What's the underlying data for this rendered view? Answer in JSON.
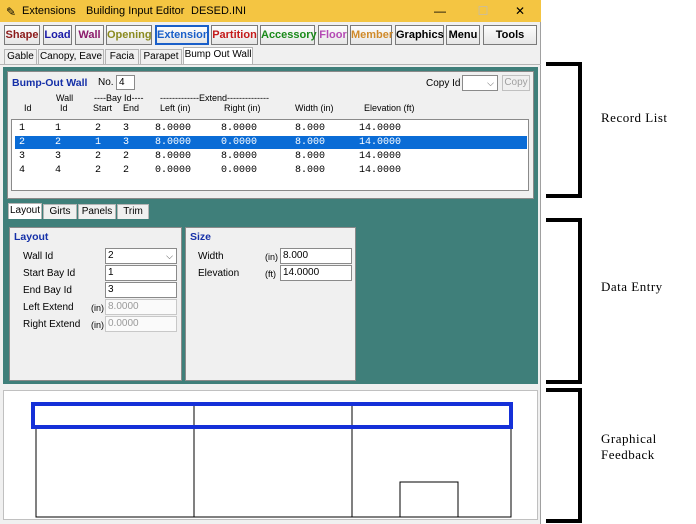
{
  "window": {
    "menu_extensions": "Extensions",
    "app_title": "Building Input Editor",
    "file": "DESED.INI",
    "min": "—",
    "max": "☐",
    "close": "✕"
  },
  "toolbar": [
    {
      "label": "Shape",
      "color": "#8b1a1a"
    },
    {
      "label": "Load",
      "color": "#1a1aa8"
    },
    {
      "label": "Wall",
      "color": "#8b1a6b"
    },
    {
      "label": "Opening",
      "color": "#8a8a20"
    },
    {
      "label": "Extension",
      "color": "#1a5fc9"
    },
    {
      "label": "Partition",
      "color": "#c41a1a"
    },
    {
      "label": "Accessory",
      "color": "#1a8a1a"
    },
    {
      "label": "Floor",
      "color": "#b44ab4"
    },
    {
      "label": "Member",
      "color": "#d08a2a"
    },
    {
      "label": "Graphics",
      "color": "#000000"
    },
    {
      "label": "Menu",
      "color": "#000000"
    },
    {
      "label": "Tools",
      "color": "#000000"
    }
  ],
  "subtabs": [
    "Gable",
    "Canopy, Eave",
    "Facia",
    "Parapet",
    "Bump Out Wall"
  ],
  "record": {
    "title": "Bump-Out Wall",
    "no_label": "No.",
    "no_value": "4",
    "copy_id_label": "Copy Id",
    "copy_btn": "Copy",
    "headers": {
      "id": "Id",
      "wall": "Wall",
      "wall_id": "Id",
      "bay_group": "----Bay Id----",
      "bay_start": "Start",
      "bay_end": "End",
      "extend_group": "-------------Extend--------------",
      "left": "Left (in)",
      "right": "Right (in)",
      "width": "Width (in)",
      "elevation": "Elevation (ft)"
    },
    "rows": [
      {
        "id": "1",
        "wall": "1",
        "start": "2",
        "end": "3",
        "left": "8.0000",
        "right": "8.0000",
        "width": "8.000",
        "elev": "14.0000"
      },
      {
        "id": "2",
        "wall": "2",
        "start": "1",
        "end": "3",
        "left": "8.0000",
        "right": "0.0000",
        "width": "8.000",
        "elev": "14.0000"
      },
      {
        "id": "3",
        "wall": "3",
        "start": "2",
        "end": "2",
        "left": "8.0000",
        "right": "8.0000",
        "width": "8.000",
        "elev": "14.0000"
      },
      {
        "id": "4",
        "wall": "4",
        "start": "2",
        "end": "2",
        "left": "0.0000",
        "right": "0.0000",
        "width": "8.000",
        "elev": "14.0000"
      }
    ]
  },
  "entry_tabs": [
    "Layout",
    "Girts",
    "Panels",
    "Trim"
  ],
  "layout": {
    "title": "Layout",
    "wall_id_label": "Wall Id",
    "wall_id_value": "2",
    "start_bay_label": "Start Bay Id",
    "start_bay_value": "1",
    "end_bay_label": "End Bay Id",
    "end_bay_value": "3",
    "left_extend_label": "Left Extend",
    "left_unit": "(in)",
    "left_value": "8.0000",
    "right_extend_label": "Right Extend",
    "right_unit": "(in)",
    "right_value": "0.0000"
  },
  "size": {
    "title": "Size",
    "width_label": "Width",
    "width_unit": "(in)",
    "width_value": "8.000",
    "elev_label": "Elevation",
    "elev_unit": "(ft)",
    "elev_value": "14.0000"
  },
  "annotations": {
    "record_list": "Record List",
    "data_entry": "Data Entry",
    "graphical_1": "Graphical",
    "graphical_2": "Feedback"
  },
  "colors": {
    "teal": "#3f7f7a",
    "selection": "#0a6cd6",
    "highlight": "#1530d8",
    "titlebar": "#f4c542"
  }
}
